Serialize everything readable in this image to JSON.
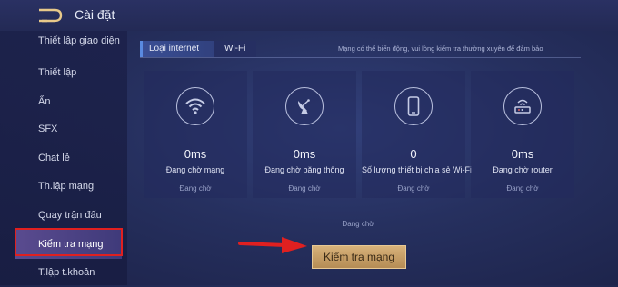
{
  "header": {
    "title": "Cài đặt",
    "back_icon": "back-arrow-icon"
  },
  "sidebar": {
    "items": [
      {
        "label": "Thiết lập giao diện"
      },
      {
        "label": "Thiết lập"
      },
      {
        "label": "Ẩn"
      },
      {
        "label": "SFX"
      },
      {
        "label": "Chat lẻ"
      },
      {
        "label": "Th.lập mạng"
      },
      {
        "label": "Quay trận đấu"
      },
      {
        "label": "Kiểm tra mạng"
      },
      {
        "label": "T.lập t.khoản"
      }
    ],
    "active_index": 7
  },
  "tabs": [
    {
      "label": "Loại internet"
    },
    {
      "label": "Wi-Fi"
    }
  ],
  "notice": "Mạng có thể biến động, vui lòng kiểm tra thường xuyên để đảm bảo",
  "cards": [
    {
      "icon": "wifi-icon",
      "value": "0ms",
      "label": "Đang chờ mạng",
      "status": "Đang chờ"
    },
    {
      "icon": "satellite-dish-icon",
      "value": "0ms",
      "label": "Đang chờ băng thông",
      "status": "Đang chờ"
    },
    {
      "icon": "phone-icon",
      "value": "0",
      "label": "Số lượng thiết bị chia sẻ Wi-Fi",
      "status": "Đang chờ"
    },
    {
      "icon": "router-icon",
      "value": "0ms",
      "label": "Đang chờ router",
      "status": "Đang chờ"
    }
  ],
  "overall_status": "Đang chờ",
  "check_button": "Kiểm tra mạng",
  "colors": {
    "accent_gold": "#c9a066",
    "highlight_red": "#e02020",
    "active_item": "#4f4586"
  }
}
